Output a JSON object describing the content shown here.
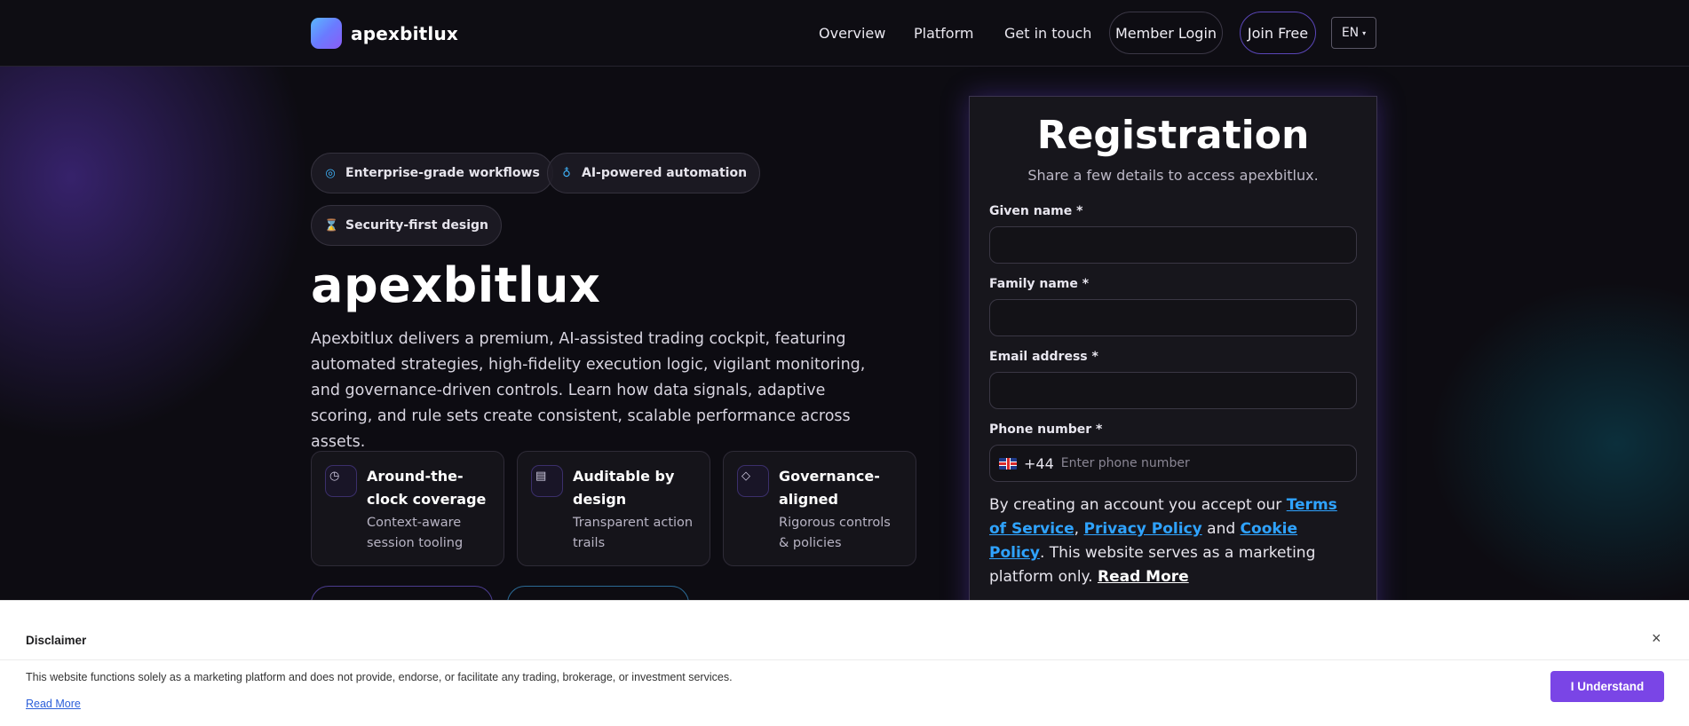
{
  "brand": {
    "name": "apexbitlux"
  },
  "nav": {
    "links": [
      "Overview",
      "Platform",
      "Get in touch"
    ],
    "member_login": "Member Login",
    "join_free": "Join Free",
    "language": "EN"
  },
  "hero": {
    "chips": [
      {
        "icon": "check-circle-icon",
        "label": "Enterprise-grade workflows"
      },
      {
        "icon": "lightbulb-icon",
        "label": "AI-powered automation"
      },
      {
        "icon": "hourglass-icon",
        "label": "Security-first design"
      }
    ],
    "title": "apexbitlux",
    "description": "Apexbitlux delivers a premium, AI-assisted trading cockpit, featuring automated strategies, high-fidelity execution logic, vigilant monitoring, and governance-driven controls. Learn how data signals, adaptive scoring, and rule sets create consistent, scalable performance across assets.",
    "features": [
      {
        "icon": "clock-icon",
        "title": "Around-the-clock coverage",
        "subtitle": "Context-aware session tooling"
      },
      {
        "icon": "document-icon",
        "title": "Auditable by design",
        "subtitle": "Transparent action trails"
      },
      {
        "icon": "diamond-icon",
        "title": "Governance-aligned",
        "subtitle": "Rigorous controls & policies"
      }
    ]
  },
  "registration": {
    "title": "Registration",
    "subtitle": "Share a few details to access apexbitlux.",
    "given_name_label": "Given name *",
    "family_name_label": "Family name *",
    "email_label": "Email address *",
    "phone_label": "Phone number *",
    "dial_code": "+44",
    "phone_placeholder": "Enter phone number",
    "consent": {
      "prefix": "By creating an account you accept our ",
      "terms": "Terms of Service",
      "sep1": ", ",
      "privacy": "Privacy Policy",
      "and": " and ",
      "cookie": "Cookie Policy",
      "suffix": ". This website serves as a marketing platform only. ",
      "read_more": "Read More"
    }
  },
  "disclaimer": {
    "title": "Disclaimer",
    "close": "×",
    "text": "This website functions solely as a marketing platform and does not provide, endorse, or facilitate any trading, brokerage, or investment services.",
    "read_more": "Read More",
    "button": "I Understand"
  },
  "colors": {
    "accent_purple": "#7a45e6",
    "link_blue": "#2fa3ff",
    "chip_icon_blue": "#3fb7ff"
  }
}
